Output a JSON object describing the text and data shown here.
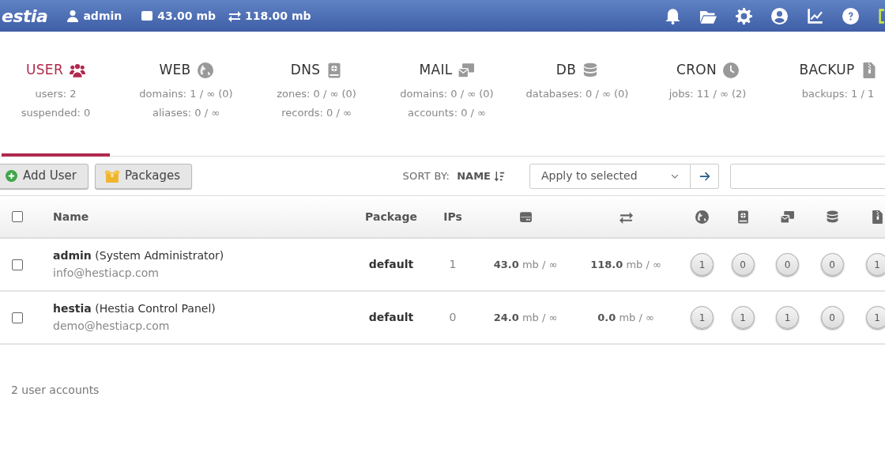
{
  "topbar": {
    "logo": "estia",
    "user": "admin",
    "disk": "**43.00** mb",
    "bandwidth": "**118.00** mb"
  },
  "tabs": [
    {
      "title": "USER",
      "selected": true,
      "lines": [
        "users: 2",
        "suspended: 0"
      ]
    },
    {
      "title": "WEB",
      "selected": false,
      "lines": [
        "domains: 1 / ∞ (0)",
        "aliases: 0 / ∞"
      ]
    },
    {
      "title": "DNS",
      "selected": false,
      "lines": [
        "zones: 0 / ∞ (0)",
        "records: 0 / ∞"
      ]
    },
    {
      "title": "MAIL",
      "selected": false,
      "lines": [
        "domains: 0 / ∞ (0)",
        "accounts: 0 / ∞"
      ]
    },
    {
      "title": "DB",
      "selected": false,
      "lines": [
        "databases: 0 / ∞ (0)"
      ]
    },
    {
      "title": "CRON",
      "selected": false,
      "lines": [
        "jobs: 11 / ∞ (2)"
      ]
    },
    {
      "title": "BACKUP",
      "selected": false,
      "lines": [
        "backups: 1 / 1"
      ]
    }
  ],
  "toolbar": {
    "buttons": [
      "Add User",
      "Packages"
    ],
    "sort_label": "SORT BY:",
    "sort_field": "NAME",
    "action_select": "Apply to selected"
  },
  "table": {
    "columns": [
      "Name",
      "Package",
      "IPs"
    ],
    "select_all_checked": false,
    "rows": [
      {
        "checked": false,
        "name": "**admin** (System Administrator)",
        "email": "info@hestiacp.com",
        "package": "default",
        "ips": "1",
        "disk": "**43.0** mb / ∞",
        "bandwidth": "**118.0** mb / ∞",
        "counts": [
          "1",
          "0",
          "0",
          "0",
          "1"
        ]
      },
      {
        "checked": false,
        "name": "**hestia** (Hestia Control Panel)",
        "email": "demo@hestiacp.com",
        "package": "default",
        "ips": "0",
        "disk": "**24.0** mb / ∞",
        "bandwidth": "**0.0** mb / ∞",
        "counts": [
          "1",
          "1",
          "1",
          "0",
          "1"
        ]
      }
    ]
  },
  "footer": "2 user accounts"
}
